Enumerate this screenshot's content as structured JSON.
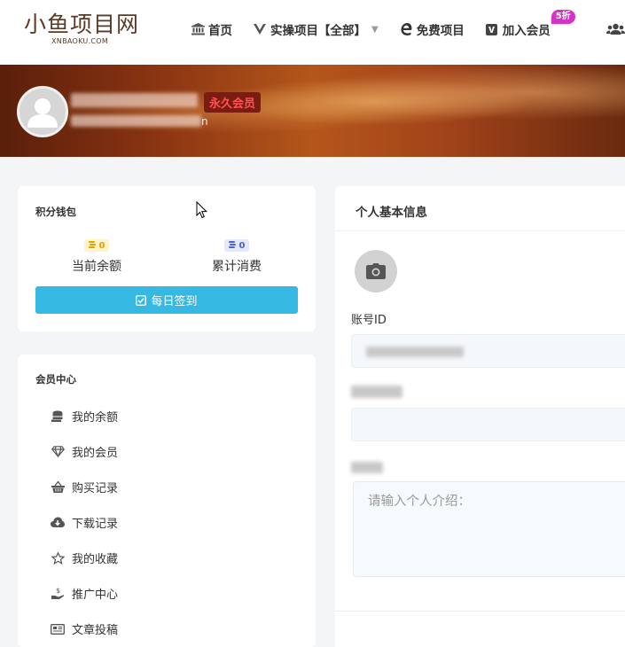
{
  "header": {
    "logo_text": "小鱼项目网",
    "logo_sub": "XNBAOKU.COM",
    "nav": [
      {
        "label": "首页",
        "icon": "bank-icon"
      },
      {
        "label": "实操项目【全部】",
        "icon": "vuejs-icon",
        "has_dropdown": true
      },
      {
        "label": "免费项目",
        "icon": "edge-icon"
      },
      {
        "label": "加入会员",
        "icon": "vip-icon",
        "badge": "5折"
      }
    ],
    "user_icon": "users-icon"
  },
  "banner": {
    "vip_tag": "永久会员",
    "email_tail": "n"
  },
  "wallet": {
    "title": "积分钱包",
    "balance_value": "0",
    "balance_label": "当前余额",
    "spent_value": "0",
    "spent_label": "累计消费",
    "checkin_label": "每日签到"
  },
  "member_center": {
    "title": "会员中心",
    "items": [
      {
        "label": "我的余额",
        "icon": "coins-icon"
      },
      {
        "label": "我的会员",
        "icon": "diamond-icon"
      },
      {
        "label": "购买记录",
        "icon": "basket-icon"
      },
      {
        "label": "下载记录",
        "icon": "cloud-download-icon"
      },
      {
        "label": "我的收藏",
        "icon": "star-icon"
      },
      {
        "label": "推广中心",
        "icon": "hand-money-icon"
      },
      {
        "label": "文章投稿",
        "icon": "newspaper-icon"
      }
    ]
  },
  "profile": {
    "title": "个人基本信息",
    "account_id_label": "账号ID",
    "bio_placeholder": "请输入个人介绍："
  },
  "colors": {
    "accent": "#35b8e2",
    "vip_text": "#ff5252",
    "badge_bg": "#d633c6"
  }
}
